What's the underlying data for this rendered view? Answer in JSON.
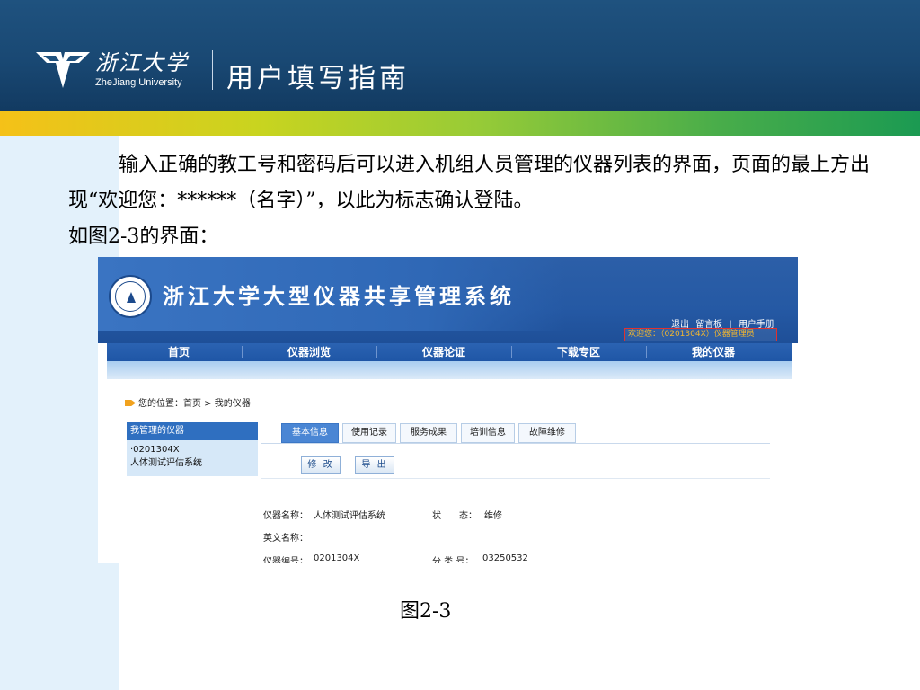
{
  "slide": {
    "logo_cn": "浙江大学",
    "logo_en": "ZheJiang University",
    "title": "用户填写指南",
    "paragraph_1": "输入正确的教工号和密码后可以进入机组人员管理的仪器列表的界面，页面的最上方出现“欢迎您：******（名字）”，以此为标志确认登陆。",
    "paragraph_2": "如图2-3的界面：",
    "caption": "图2-3"
  },
  "screenshot": {
    "system_title": "浙江大学大型仪器共享管理系统",
    "top_links": [
      "退出",
      "留言板",
      "|",
      "用户手册"
    ],
    "welcome": "欢迎您：（0201304X）仪器管理员",
    "nav": [
      "首页",
      "仪器浏览",
      "仪器论证",
      "下载专区",
      "我的仪器"
    ],
    "breadcrumb": "您的位置：首页 > 我的仪器",
    "side_panel": {
      "heading": "我管理的仪器",
      "item_id": "·0201304X",
      "item_name": "人体测试评估系统"
    },
    "tabs": [
      "基本信息",
      "使用记录",
      "服务成果",
      "培训信息",
      "故障维修"
    ],
    "buttons": [
      "修 改",
      "导 出"
    ],
    "fields": {
      "name_label": "仪器名称：",
      "name_value": "人体测试评估系统",
      "status_label": "状　　态：",
      "status_value": "维修",
      "en_name_label": "英文名称：",
      "en_name_value": "",
      "number_label": "仪器编号：",
      "number_value": "0201304X",
      "class_label": "分 类 号：",
      "class_value": "03250532"
    }
  }
}
